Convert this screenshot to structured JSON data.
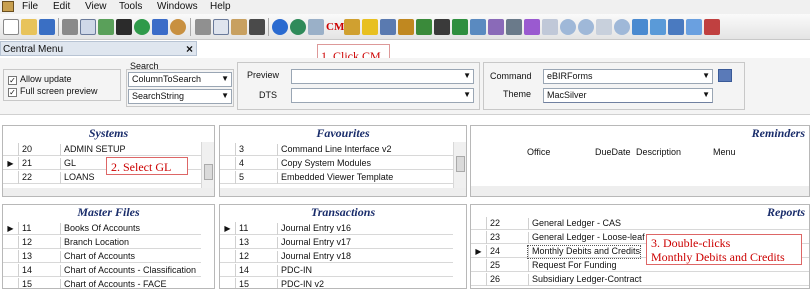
{
  "menu": [
    "File",
    "Edit",
    "View",
    "Tools",
    "Windows",
    "Help"
  ],
  "toolbar": {
    "cm_label": "CM",
    "buttons": [
      "new-icon",
      "open-icon",
      "save-icon",
      "print-icon",
      "preview-icon",
      "export-icon",
      "up-icon",
      "refresh-icon",
      "undo-icon",
      "find-icon",
      "cut-icon",
      "copy-icon",
      "paste-icon",
      "grid-icon",
      "help-icon",
      "info-icon",
      "calculator-icon",
      "cm-icon",
      "edit-icon",
      "star-icon",
      "user-icon",
      "g-icon",
      "pin-icon",
      "table-icon",
      "excel-icon",
      "chart-icon",
      "key-icon",
      "eye-icon",
      "zoom-out-icon",
      "zoom-in-icon",
      "list-icon",
      "zoom-icon",
      "filter-icon",
      "filter-icon-2",
      "funnel-icon"
    ]
  },
  "annotations": {
    "step1": "1. Click CM",
    "step2": "2. Select GL",
    "step3_line1": "3. Double-clicks",
    "step3_line2": "Monthly Debits and Credits"
  },
  "panel": {
    "title": "Central Menu",
    "close": "×"
  },
  "options": {
    "allow_update": "Allow update",
    "full_screen_preview": "Full screen preview",
    "search_label": "Search",
    "search_column": "ColumnToSearch",
    "search_string": "SearchString",
    "preview_label": "Preview",
    "dts_label": "DTS",
    "command_label": "Command",
    "command_value": "eBIRForms",
    "theme_label": "Theme",
    "theme_value": "MacSilver"
  },
  "systems": {
    "title": "Systems",
    "rows": [
      {
        "num": "20",
        "label": "ADMIN SETUP",
        "current": false
      },
      {
        "num": "21",
        "label": "GL",
        "current": true
      },
      {
        "num": "22",
        "label": "LOANS",
        "current": false
      }
    ]
  },
  "favourites": {
    "title": "Favourites",
    "rows": [
      {
        "num": "3",
        "label": "Command Line Interface v2"
      },
      {
        "num": "4",
        "label": "Copy System Modules"
      },
      {
        "num": "5",
        "label": "Embedded Viewer Template"
      }
    ]
  },
  "reminders": {
    "title": "Reminders",
    "columns": [
      "Office",
      "DueDate",
      "Description",
      "Menu"
    ]
  },
  "master_files": {
    "title": "Master Files",
    "rows": [
      {
        "num": "11",
        "label": "Books Of Accounts",
        "current": true
      },
      {
        "num": "12",
        "label": "Branch Location",
        "current": false
      },
      {
        "num": "13",
        "label": "Chart of Accounts",
        "current": false
      },
      {
        "num": "14",
        "label": "Chart of Accounts - Classification",
        "current": false
      },
      {
        "num": "15",
        "label": "Chart of Accounts - FACE",
        "current": false
      }
    ]
  },
  "transactions": {
    "title": "Transactions",
    "rows": [
      {
        "num": "11",
        "label": "Journal Entry v16",
        "current": true
      },
      {
        "num": "13",
        "label": "Journal Entry v17",
        "current": false
      },
      {
        "num": "12",
        "label": "Journal Entry v18",
        "current": false
      },
      {
        "num": "14",
        "label": "PDC-IN",
        "current": false
      },
      {
        "num": "15",
        "label": "PDC-IN v2",
        "current": false
      }
    ]
  },
  "reports": {
    "title": "Reports",
    "rows": [
      {
        "num": "22",
        "label": "General Ledger - CAS",
        "current": false
      },
      {
        "num": "23",
        "label": "General Ledger - Loose-leaf",
        "current": false
      },
      {
        "num": "24",
        "label": "Monthly Debits and Credits",
        "current": true
      },
      {
        "num": "25",
        "label": "Request For Funding",
        "current": false
      },
      {
        "num": "26",
        "label": "Subsidiary Ledger-Contract",
        "current": false
      }
    ]
  },
  "colors": {
    "heading": "#1a2d6b",
    "annotation": "#cc0000"
  }
}
